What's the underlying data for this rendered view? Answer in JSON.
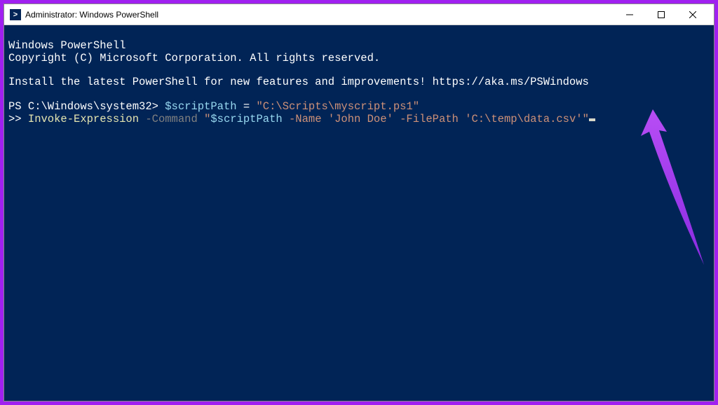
{
  "titlebar": {
    "title": "Administrator: Windows PowerShell"
  },
  "terminal": {
    "header1": "Windows PowerShell",
    "header2": "Copyright (C) Microsoft Corporation. All rights reserved.",
    "install_msg": "Install the latest PowerShell for new features and improvements! https://aka.ms/PSWindows",
    "prompt1_prefix": "PS C:\\Windows\\system32> ",
    "line1_var": "$scriptPath",
    "line1_eq": " = ",
    "line1_value": "\"C:\\Scripts\\myscript.ps1\"",
    "prompt2_prefix": ">> ",
    "line2_cmd": "Invoke-Expression",
    "line2_param": " -Command ",
    "line2_str_open": "\"",
    "line2_var": "$scriptPath",
    "line2_rest": " -Name 'John Doe' -FilePath 'C:\\temp\\data.csv'\""
  },
  "colors": {
    "accent": "#a020f0",
    "terminal_bg": "#012456",
    "variable": "#98d8f0",
    "parameter": "#808080",
    "string": "#ce9178",
    "command": "#e5e5b0"
  }
}
